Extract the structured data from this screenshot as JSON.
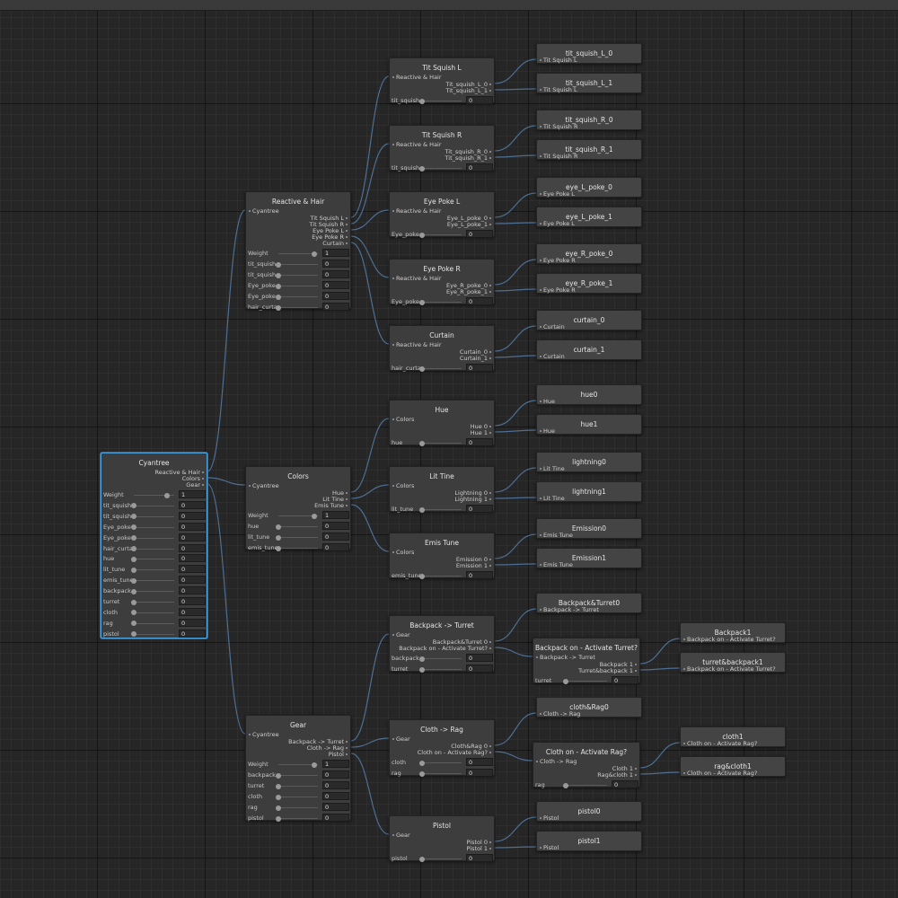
{
  "colors": {
    "wire": "#4d6f94",
    "selected": "#4aa3e0",
    "background": "#262626",
    "node": "#3d3d3d"
  },
  "nodes": [
    {
      "title": "Cyantree",
      "inputs": [],
      "outputs": [
        "Reactive & Hair",
        "Colors",
        "Gear"
      ],
      "params": [
        {
          "label": "Weight",
          "value": "1",
          "pos": 0.82
        },
        {
          "label": "tit_squish",
          "value": "0",
          "pos": 0
        },
        {
          "label": "tit_squish",
          "value": "0",
          "pos": 0
        },
        {
          "label": "Eye_poke",
          "value": "0",
          "pos": 0
        },
        {
          "label": "Eye_poke",
          "value": "0",
          "pos": 0
        },
        {
          "label": "hair_curta",
          "value": "0",
          "pos": 0
        },
        {
          "label": "hue",
          "value": "0",
          "pos": 0
        },
        {
          "label": "lit_tune",
          "value": "0",
          "pos": 0
        },
        {
          "label": "emis_tune",
          "value": "0",
          "pos": 0
        },
        {
          "label": "backpack",
          "value": "0",
          "pos": 0
        },
        {
          "label": "turret",
          "value": "0",
          "pos": 0
        },
        {
          "label": "cloth",
          "value": "0",
          "pos": 0
        },
        {
          "label": "rag",
          "value": "0",
          "pos": 0
        },
        {
          "label": "pistol",
          "value": "0",
          "pos": 0
        }
      ]
    },
    {
      "title": "Reactive & Hair",
      "inputs": [
        "Cyantree"
      ],
      "outputs": [
        "Tit Squish L",
        "Tit Squish R",
        "Eye Poke L",
        "Eye Poke R",
        "Curtain"
      ],
      "params": [
        {
          "label": "Weight",
          "value": "1",
          "pos": 0.9
        },
        {
          "label": "tit_squish",
          "value": "0",
          "pos": 0
        },
        {
          "label": "tit_squish",
          "value": "0",
          "pos": 0
        },
        {
          "label": "Eye_poke",
          "value": "0",
          "pos": 0
        },
        {
          "label": "Eye_poke",
          "value": "0",
          "pos": 0
        },
        {
          "label": "hair_curta",
          "value": "0",
          "pos": 0
        }
      ]
    },
    {
      "title": "Colors",
      "inputs": [
        "Cyantree"
      ],
      "outputs": [
        "Hue",
        "Lit Tine",
        "Emis Tune"
      ],
      "params": [
        {
          "label": "Weight",
          "value": "1",
          "pos": 0.9
        },
        {
          "label": "hue",
          "value": "0",
          "pos": 0
        },
        {
          "label": "lit_tune",
          "value": "0",
          "pos": 0
        },
        {
          "label": "emis_tune",
          "value": "0",
          "pos": 0
        }
      ]
    },
    {
      "title": "Gear",
      "inputs": [
        "Cyantree"
      ],
      "outputs": [
        "Backpack -> Turret",
        "Cloth -> Rag",
        "Pistol"
      ],
      "params": [
        {
          "label": "Weight",
          "value": "1",
          "pos": 0.9
        },
        {
          "label": "backpack",
          "value": "0",
          "pos": 0
        },
        {
          "label": "turret",
          "value": "0",
          "pos": 0
        },
        {
          "label": "cloth",
          "value": "0",
          "pos": 0
        },
        {
          "label": "rag",
          "value": "0",
          "pos": 0
        },
        {
          "label": "pistol",
          "value": "0",
          "pos": 0
        }
      ]
    },
    {
      "title": "Tit Squish L",
      "inputs": [
        "Reactive & Hair"
      ],
      "outputs": [
        "Tit_squish_L_0",
        "Tit_squish_L_1"
      ],
      "params": [
        {
          "label": "tit_squish",
          "value": "0",
          "pos": 0
        }
      ]
    },
    {
      "title": "Tit Squish R",
      "inputs": [
        "Reactive & Hair"
      ],
      "outputs": [
        "Tit_squish_R_0",
        "Tit_squish_R_1"
      ],
      "params": [
        {
          "label": "tit_squish",
          "value": "0",
          "pos": 0
        }
      ]
    },
    {
      "title": "Eye Poke L",
      "inputs": [
        "Reactive & Hair"
      ],
      "outputs": [
        "Eye_L_poke_0",
        "Eye_L_poke_1"
      ],
      "params": [
        {
          "label": "Eye_poke",
          "value": "0",
          "pos": 0
        }
      ]
    },
    {
      "title": "Eye Poke R",
      "inputs": [
        "Reactive & Hair"
      ],
      "outputs": [
        "Eye_R_poke_0",
        "Eye_R_poke_1"
      ],
      "params": [
        {
          "label": "Eye_poke",
          "value": "0",
          "pos": 0
        }
      ]
    },
    {
      "title": "Curtain",
      "inputs": [
        "Reactive & Hair"
      ],
      "outputs": [
        "Curtain_0",
        "Curtain_1"
      ],
      "params": [
        {
          "label": "hair_curta",
          "value": "0",
          "pos": 0
        }
      ]
    },
    {
      "title": "Hue",
      "inputs": [
        "Colors"
      ],
      "outputs": [
        "Hue 0",
        "Hue 1"
      ],
      "params": [
        {
          "label": "hue",
          "value": "0",
          "pos": 0
        }
      ]
    },
    {
      "title": "Lit Tine",
      "inputs": [
        "Colors"
      ],
      "outputs": [
        "Lightning 0",
        "Lightning 1"
      ],
      "params": [
        {
          "label": "lit_tune",
          "value": "0",
          "pos": 0
        }
      ]
    },
    {
      "title": "Emis Tune",
      "inputs": [
        "Colors"
      ],
      "outputs": [
        "Emission 0",
        "Emission 1"
      ],
      "params": [
        {
          "label": "emis_tune",
          "value": "0",
          "pos": 0
        }
      ]
    },
    {
      "title": "Backpack -> Turret",
      "inputs": [
        "Gear"
      ],
      "outputs": [
        "Backpack&Turret 0",
        "Backpack on - Activate Turret?"
      ],
      "params": [
        {
          "label": "backpack",
          "value": "0",
          "pos": 0
        },
        {
          "label": "turret",
          "value": "0",
          "pos": 0
        }
      ]
    },
    {
      "title": "Cloth -> Rag",
      "inputs": [
        "Gear"
      ],
      "outputs": [
        "Cloth&Rag 0",
        "Cloth on - Activate Rag?"
      ],
      "params": [
        {
          "label": "cloth",
          "value": "0",
          "pos": 0
        },
        {
          "label": "rag",
          "value": "0",
          "pos": 0
        }
      ]
    },
    {
      "title": "Pistol",
      "inputs": [
        "Gear"
      ],
      "outputs": [
        "Pistol 0",
        "Pistol 1"
      ],
      "params": [
        {
          "label": "pistol",
          "value": "0",
          "pos": 0
        }
      ]
    },
    {
      "title": "Backpack on - Activate Turret?",
      "inputs": [
        "Backpack -> Turret"
      ],
      "outputs": [
        "Backpack 1",
        "Turret&backpack 1"
      ],
      "params": [
        {
          "label": "turret",
          "value": "0",
          "pos": 0
        }
      ]
    },
    {
      "title": "Cloth on - Activate Rag?",
      "inputs": [
        "Cloth -> Rag"
      ],
      "outputs": [
        "Cloth 1",
        "Rag&cloth 1"
      ],
      "params": [
        {
          "label": "rag",
          "value": "0",
          "pos": 0
        }
      ]
    },
    {
      "title": "tit_squish_L_0",
      "inputs": [
        "Tit Squish L"
      ],
      "outputs": [],
      "params": []
    },
    {
      "title": "tit_squish_L_1",
      "inputs": [
        "Tit Squish L"
      ],
      "outputs": [],
      "params": []
    },
    {
      "title": "tit_squish_R_0",
      "inputs": [
        "Tit Squish R"
      ],
      "outputs": [],
      "params": []
    },
    {
      "title": "tit_squish_R_1",
      "inputs": [
        "Tit Squish R"
      ],
      "outputs": [],
      "params": []
    },
    {
      "title": "eye_L_poke_0",
      "inputs": [
        "Eye Poke L"
      ],
      "outputs": [],
      "params": []
    },
    {
      "title": "eye_L_poke_1",
      "inputs": [
        "Eye Poke L"
      ],
      "outputs": [],
      "params": []
    },
    {
      "title": "eye_R_poke_0",
      "inputs": [
        "Eye Poke R"
      ],
      "outputs": [],
      "params": []
    },
    {
      "title": "eye_R_poke_1",
      "inputs": [
        "Eye Poke R"
      ],
      "outputs": [],
      "params": []
    },
    {
      "title": "curtain_0",
      "inputs": [
        "Curtain"
      ],
      "outputs": [],
      "params": []
    },
    {
      "title": "curtain_1",
      "inputs": [
        "Curtain"
      ],
      "outputs": [],
      "params": []
    },
    {
      "title": "hue0",
      "inputs": [
        "Hue"
      ],
      "outputs": [],
      "params": []
    },
    {
      "title": "hue1",
      "inputs": [
        "Hue"
      ],
      "outputs": [],
      "params": []
    },
    {
      "title": "lightning0",
      "inputs": [
        "Lit Tine"
      ],
      "outputs": [],
      "params": []
    },
    {
      "title": "lightning1",
      "inputs": [
        "Lit Tine"
      ],
      "outputs": [],
      "params": []
    },
    {
      "title": "Emission0",
      "inputs": [
        "Emis Tune"
      ],
      "outputs": [],
      "params": []
    },
    {
      "title": "Emission1",
      "inputs": [
        "Emis Tune"
      ],
      "outputs": [],
      "params": []
    },
    {
      "title": "Backpack&Turret0",
      "inputs": [
        "Backpack -> Turret"
      ],
      "outputs": [],
      "params": []
    },
    {
      "title": "cloth&Rag0",
      "inputs": [
        "Cloth -> Rag"
      ],
      "outputs": [],
      "params": []
    },
    {
      "title": "pistol0",
      "inputs": [
        "Pistol"
      ],
      "outputs": [],
      "params": []
    },
    {
      "title": "pistol1",
      "inputs": [
        "Pistol"
      ],
      "outputs": [],
      "params": []
    },
    {
      "title": "Backpack1",
      "inputs": [
        "Backpack on - Activate Turret?"
      ],
      "outputs": [],
      "params": []
    },
    {
      "title": "turret&backpack1",
      "inputs": [
        "Backpack on - Activate Turret?"
      ],
      "outputs": [],
      "params": []
    },
    {
      "title": "cloth1",
      "inputs": [
        "Cloth on - Activate Rag?"
      ],
      "outputs": [],
      "params": []
    },
    {
      "title": "rag&cloth1",
      "inputs": [
        "Cloth on - Activate Rag?"
      ],
      "outputs": [],
      "params": []
    }
  ],
  "edges": [
    [
      0,
      0,
      1
    ],
    [
      0,
      1,
      2
    ],
    [
      0,
      2,
      3
    ],
    [
      1,
      0,
      4
    ],
    [
      1,
      1,
      5
    ],
    [
      1,
      2,
      6
    ],
    [
      1,
      3,
      7
    ],
    [
      1,
      4,
      8
    ],
    [
      2,
      0,
      9
    ],
    [
      2,
      1,
      10
    ],
    [
      2,
      2,
      11
    ],
    [
      3,
      0,
      12
    ],
    [
      3,
      1,
      13
    ],
    [
      3,
      2,
      14
    ],
    [
      4,
      0,
      17
    ],
    [
      4,
      1,
      18
    ],
    [
      5,
      0,
      19
    ],
    [
      5,
      1,
      20
    ],
    [
      6,
      0,
      21
    ],
    [
      6,
      1,
      22
    ],
    [
      7,
      0,
      23
    ],
    [
      7,
      1,
      24
    ],
    [
      8,
      0,
      25
    ],
    [
      8,
      1,
      26
    ],
    [
      9,
      0,
      27
    ],
    [
      9,
      1,
      28
    ],
    [
      10,
      0,
      29
    ],
    [
      10,
      1,
      30
    ],
    [
      11,
      0,
      31
    ],
    [
      11,
      1,
      32
    ],
    [
      12,
      0,
      33
    ],
    [
      12,
      1,
      15
    ],
    [
      13,
      0,
      34
    ],
    [
      13,
      1,
      16
    ],
    [
      14,
      0,
      35
    ],
    [
      14,
      1,
      36
    ],
    [
      15,
      0,
      37
    ],
    [
      15,
      1,
      38
    ],
    [
      16,
      0,
      39
    ],
    [
      16,
      1,
      40
    ]
  ]
}
